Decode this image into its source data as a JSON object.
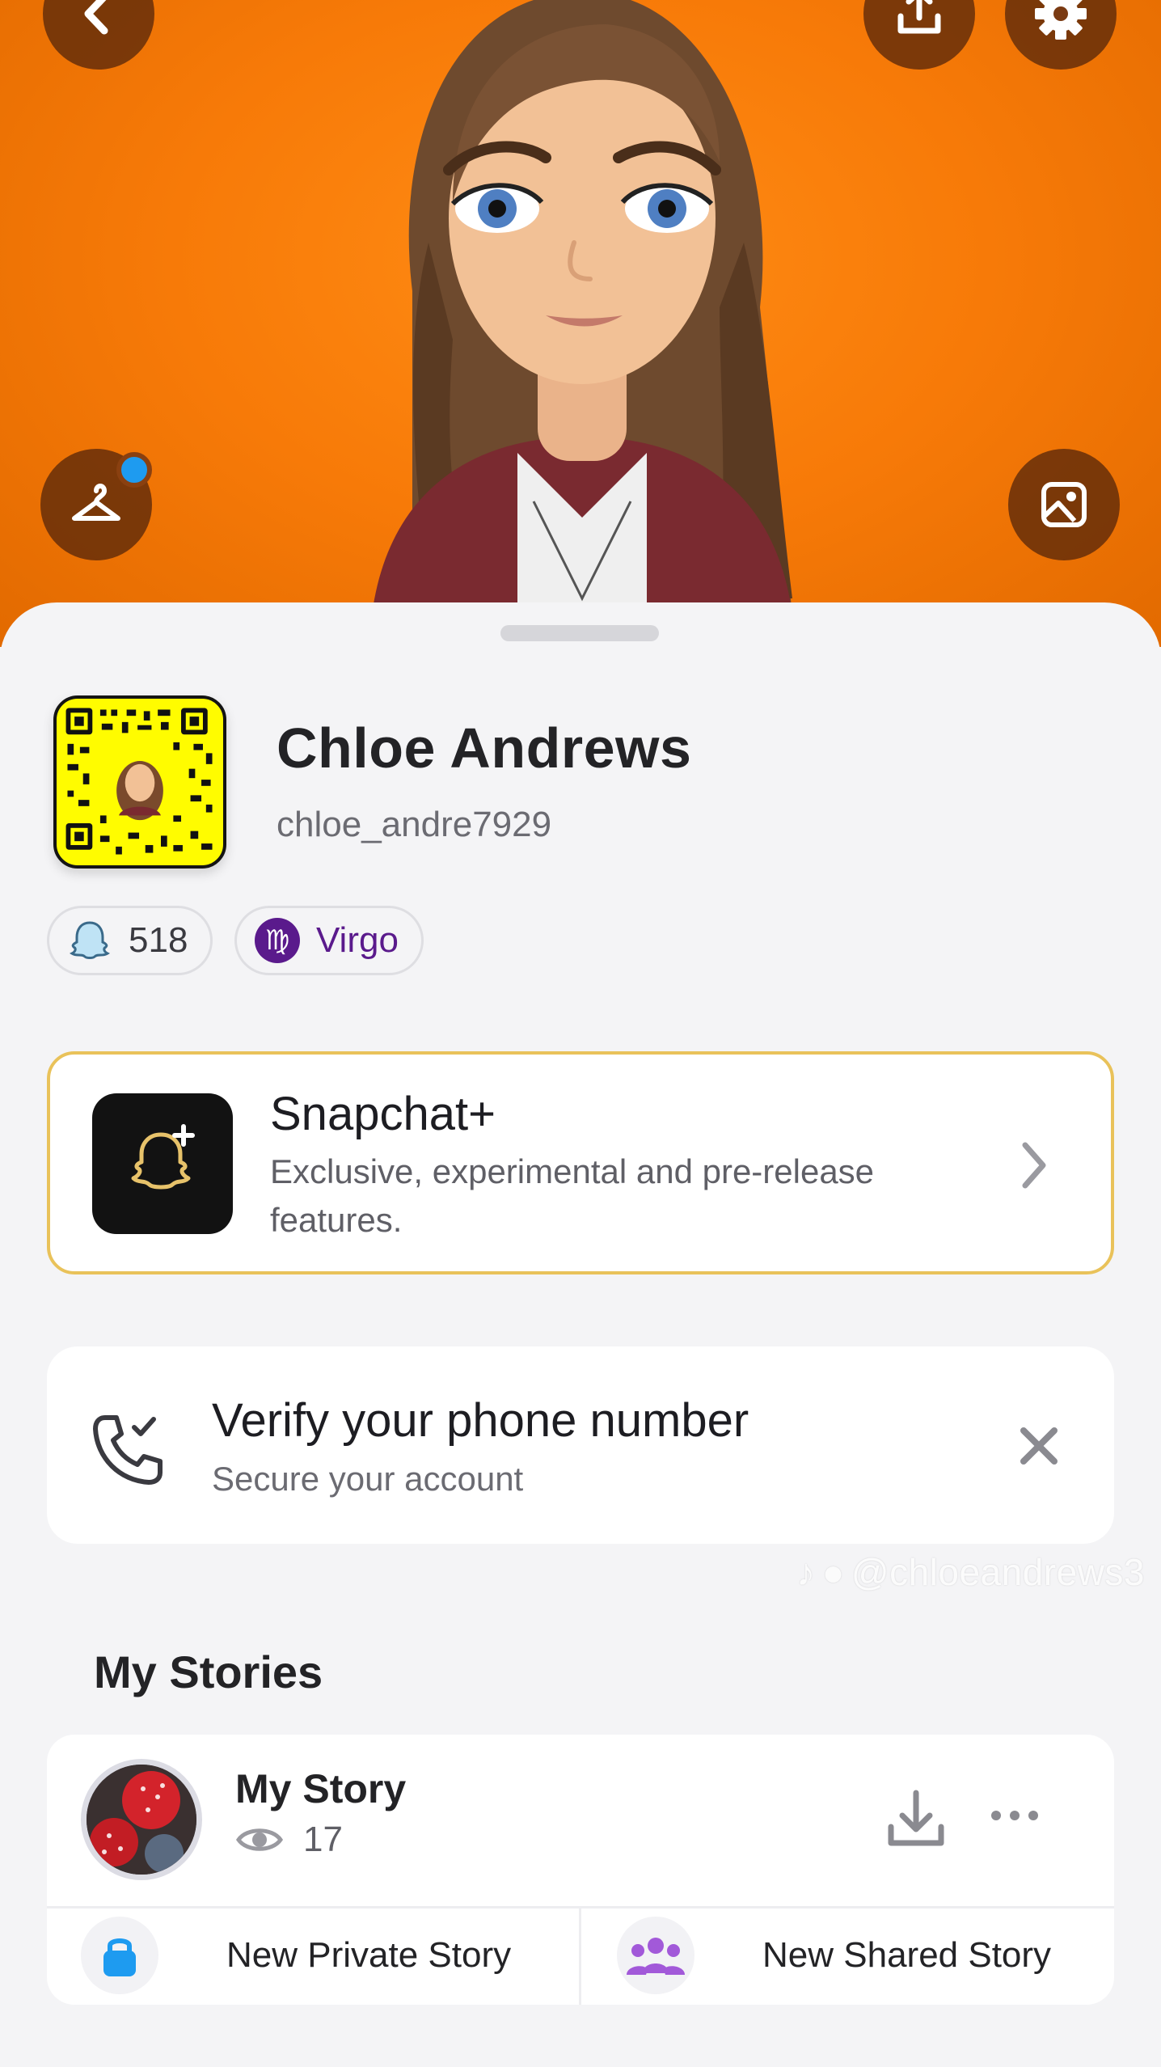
{
  "hero": {
    "back_icon": "chevron-left-icon",
    "share_icon": "upload-icon",
    "settings_icon": "gear-icon",
    "outfit_icon": "hanger-icon",
    "selfie_icon": "image-icon",
    "background_color": "#f77a08"
  },
  "profile": {
    "display_name": "Chloe Andrews",
    "username": "chloe_andre7929",
    "snapscore": "518",
    "zodiac": "Virgo",
    "zodiac_symbol": "♍"
  },
  "snapchat_plus": {
    "title": "Snapchat+",
    "description": "Exclusive, experimental and pre-release features."
  },
  "verify_phone": {
    "title": "Verify your phone number",
    "subtitle": "Secure your account"
  },
  "watermark": {
    "text": "@chloeandrews3"
  },
  "my_stories": {
    "section_title": "My Stories",
    "story_title": "My Story",
    "view_count": "17",
    "new_private_label": "New Private Story",
    "new_shared_label": "New Shared Story"
  },
  "colors": {
    "accent_blue": "#1e9bf0",
    "gold_border": "#e9c25a",
    "zodiac_purple": "#5a1a8c",
    "shared_purple": "#a259d9"
  }
}
